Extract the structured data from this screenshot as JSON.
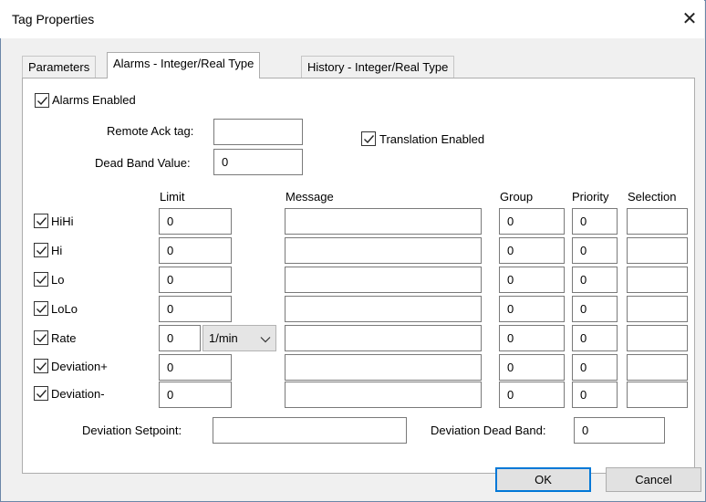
{
  "window": {
    "title": "Tag Properties",
    "close_glyph": "✕"
  },
  "tabs": [
    {
      "label": "Parameters",
      "active": false
    },
    {
      "label": "Alarms - Integer/Real Type",
      "active": true
    },
    {
      "label": "History - Integer/Real Type",
      "active": false
    }
  ],
  "alarms_enabled": {
    "label": "Alarms Enabled",
    "checked": true
  },
  "remote_ack": {
    "label": "Remote Ack tag:",
    "value": ""
  },
  "dead_band": {
    "label": "Dead Band Value:",
    "value": "0"
  },
  "translation_enabled": {
    "label": "Translation Enabled",
    "checked": true
  },
  "columns": {
    "limit": "Limit",
    "message": "Message",
    "group": "Group",
    "priority": "Priority",
    "selection": "Selection"
  },
  "rows": [
    {
      "label": "HiHi",
      "checked": true,
      "limit": "0",
      "message": "",
      "group": "0",
      "priority": "0",
      "selection": ""
    },
    {
      "label": "Hi",
      "checked": true,
      "limit": "0",
      "message": "",
      "group": "0",
      "priority": "0",
      "selection": ""
    },
    {
      "label": "Lo",
      "checked": true,
      "limit": "0",
      "message": "",
      "group": "0",
      "priority": "0",
      "selection": ""
    },
    {
      "label": "LoLo",
      "checked": true,
      "limit": "0",
      "message": "",
      "group": "0",
      "priority": "0",
      "selection": ""
    },
    {
      "label": "Rate",
      "checked": true,
      "limit": "0",
      "rate_unit": "1/min",
      "message": "",
      "group": "0",
      "priority": "0",
      "selection": ""
    },
    {
      "label": "Deviation+",
      "checked": true,
      "limit": "0",
      "message": "",
      "group": "0",
      "priority": "0",
      "selection": ""
    },
    {
      "label": "Deviation-",
      "checked": true,
      "limit": "0",
      "message": "",
      "group": "0",
      "priority": "0",
      "selection": ""
    }
  ],
  "deviation_setpoint": {
    "label": "Deviation Setpoint:",
    "value": ""
  },
  "deviation_dead_band": {
    "label": "Deviation Dead Band:",
    "value": "0"
  },
  "buttons": {
    "ok": "OK",
    "cancel": "Cancel"
  },
  "colors": {
    "focus_accent": "#0078d7",
    "window_border": "#6b86a8"
  }
}
